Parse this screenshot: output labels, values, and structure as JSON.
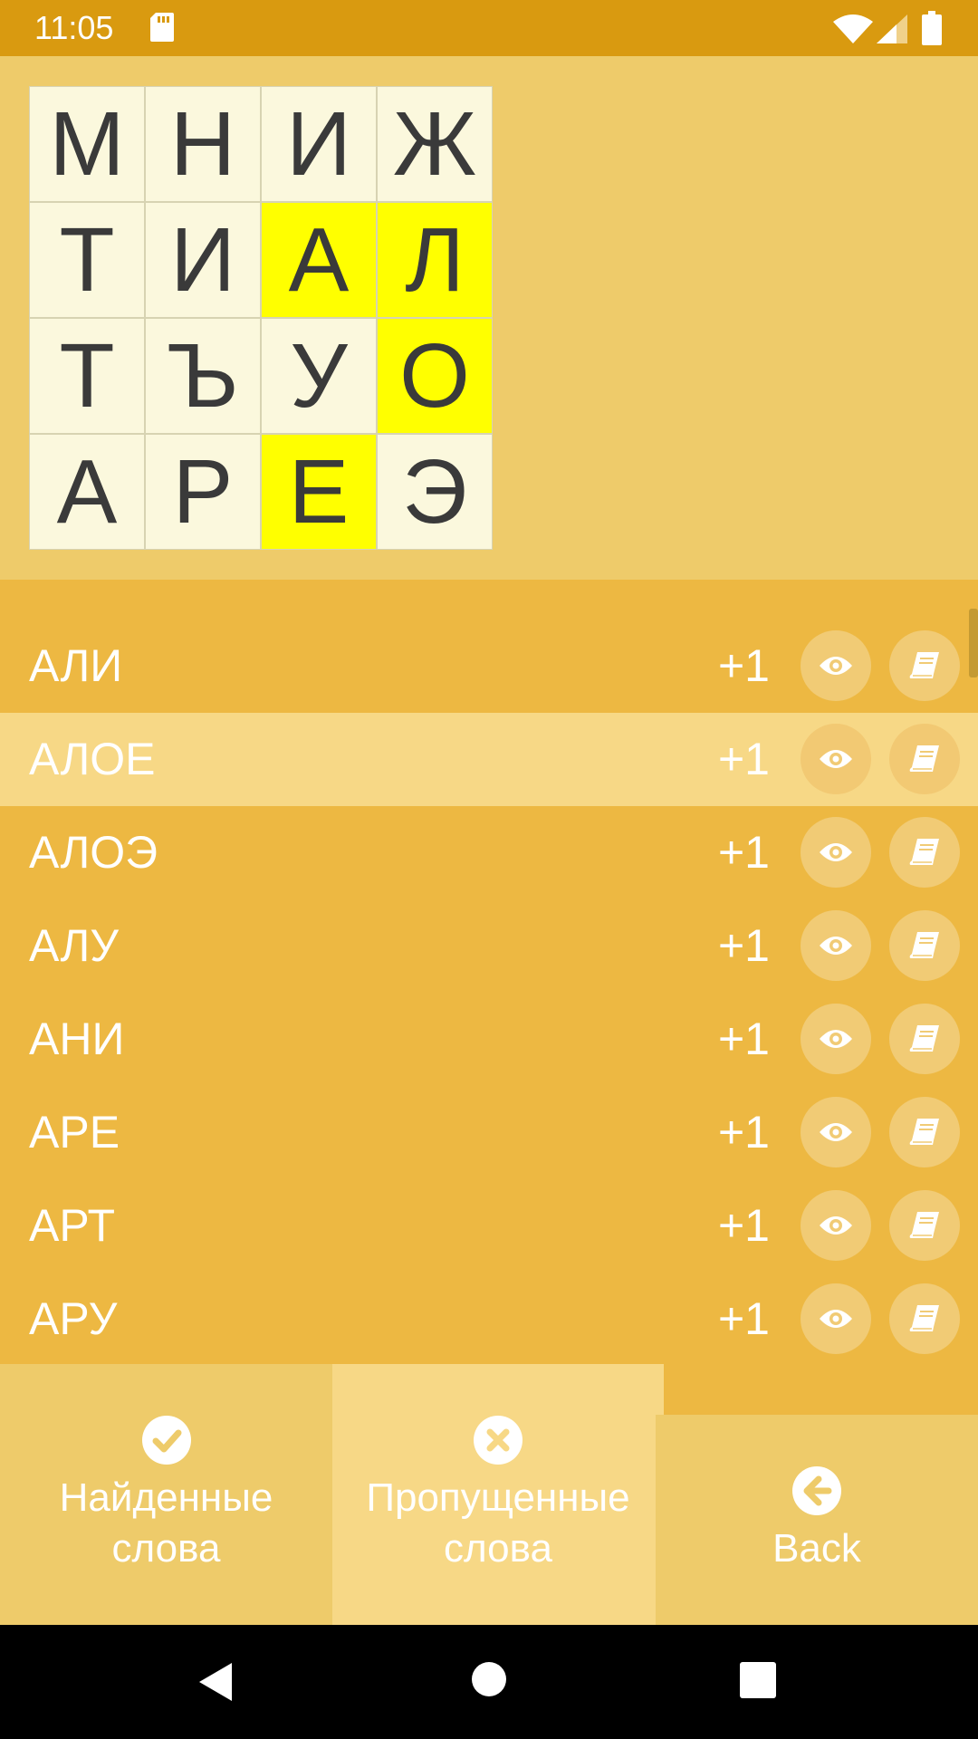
{
  "status_bar": {
    "time": "11:05"
  },
  "board": {
    "cells": [
      {
        "letter": "М",
        "highlighted": false
      },
      {
        "letter": "Н",
        "highlighted": false
      },
      {
        "letter": "И",
        "highlighted": false
      },
      {
        "letter": "Ж",
        "highlighted": false
      },
      {
        "letter": "Т",
        "highlighted": false
      },
      {
        "letter": "И",
        "highlighted": false
      },
      {
        "letter": "А",
        "highlighted": true
      },
      {
        "letter": "Л",
        "highlighted": true
      },
      {
        "letter": "Т",
        "highlighted": false
      },
      {
        "letter": "Ъ",
        "highlighted": false
      },
      {
        "letter": "У",
        "highlighted": false
      },
      {
        "letter": "О",
        "highlighted": true
      },
      {
        "letter": "А",
        "highlighted": false
      },
      {
        "letter": "Р",
        "highlighted": false
      },
      {
        "letter": "Е",
        "highlighted": true
      },
      {
        "letter": "Э",
        "highlighted": false
      }
    ]
  },
  "words": [
    {
      "word": "АЛИ",
      "score": "+1",
      "selected": false
    },
    {
      "word": "АЛОЕ",
      "score": "+1",
      "selected": true
    },
    {
      "word": "АЛОЭ",
      "score": "+1",
      "selected": false
    },
    {
      "word": "АЛУ",
      "score": "+1",
      "selected": false
    },
    {
      "word": "АНИ",
      "score": "+1",
      "selected": false
    },
    {
      "word": "АРЕ",
      "score": "+1",
      "selected": false
    },
    {
      "word": "АРТ",
      "score": "+1",
      "selected": false
    },
    {
      "word": "АРУ",
      "score": "+1",
      "selected": false
    }
  ],
  "tabs": {
    "found": {
      "label": "Найденные\nслова",
      "icon": "check-circle-icon"
    },
    "missed": {
      "label": "Пропущенные\nслова",
      "icon": "x-circle-icon",
      "active": true
    },
    "back": {
      "label": "Back",
      "icon": "arrow-left-circle-icon"
    }
  },
  "colors": {
    "status_bar": "#D99A10",
    "board_bg": "#EECB6A",
    "cell": "#FBF8DD",
    "cell_highlight": "#FFFF00",
    "list_bg": "#EDB842",
    "selected_row": "#F7D886"
  }
}
